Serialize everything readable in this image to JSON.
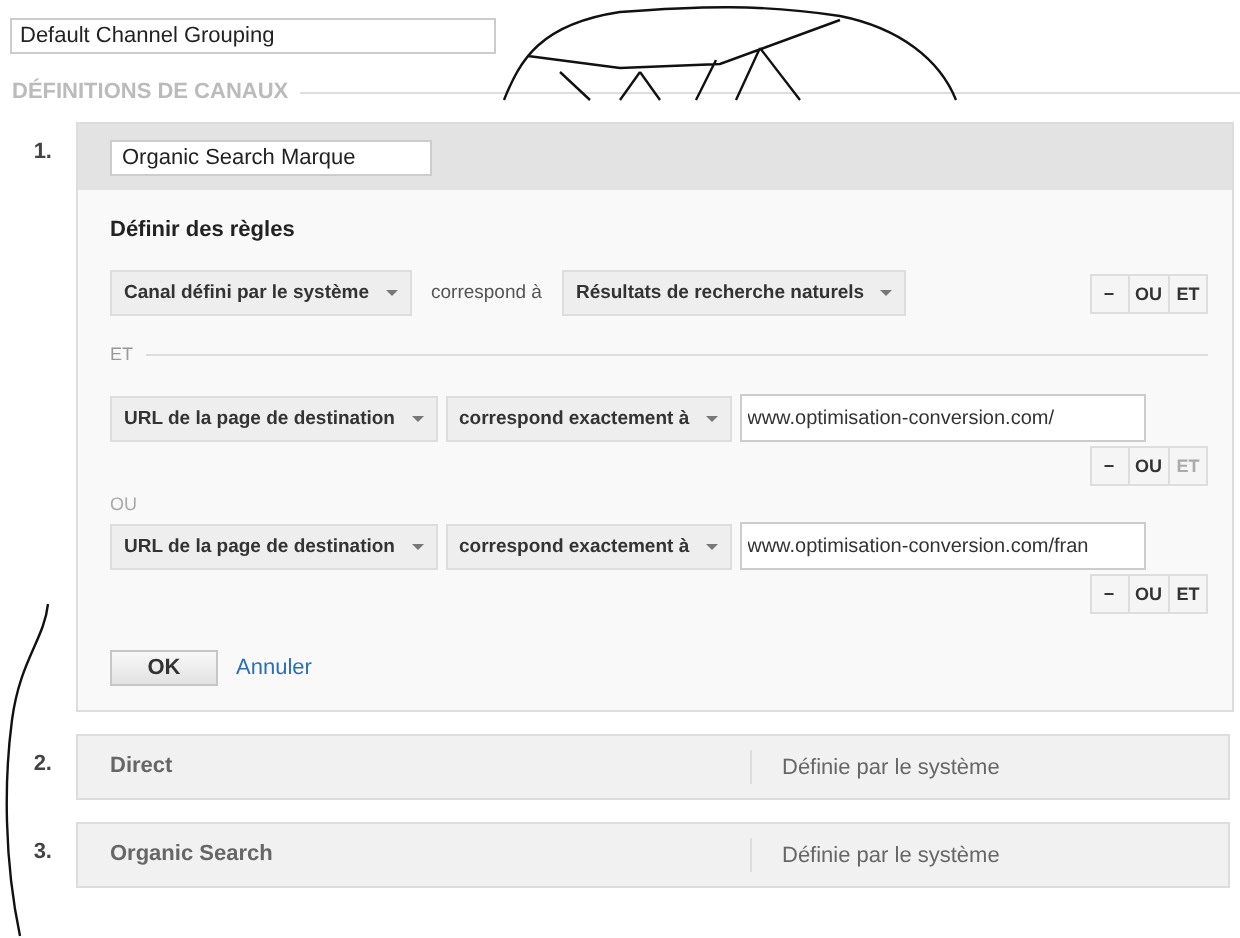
{
  "name_field": {
    "value": "Default Channel Grouping"
  },
  "section_title": "DÉFINITIONS DE CANAUX",
  "channels": [
    {
      "number": "1.",
      "expanded": true,
      "name_input": "Organic Search Marque",
      "rules_title": "Définir des règles",
      "rules": [
        {
          "kind": "rule",
          "dimension": "Canal défini par le système",
          "operator": {
            "kind": "text",
            "label": "correspond à"
          },
          "value": {
            "kind": "select",
            "label": "Résultats de recherche naturels"
          },
          "buttons": [
            {
              "label": "−",
              "disabled": false
            },
            {
              "label": "OU",
              "disabled": false
            },
            {
              "label": "ET",
              "disabled": false
            }
          ]
        },
        {
          "kind": "divider",
          "label": "ET"
        },
        {
          "kind": "rule",
          "dimension": "URL de la page de destination",
          "operator": {
            "kind": "select",
            "label": "correspond exactement à"
          },
          "value": {
            "kind": "input",
            "label": "www.optimisation-conversion.com/"
          },
          "buttons": [
            {
              "label": "−",
              "disabled": false
            },
            {
              "label": "OU",
              "disabled": false
            },
            {
              "label": "ET",
              "disabled": true
            }
          ]
        },
        {
          "kind": "label",
          "label": "OU"
        },
        {
          "kind": "rule",
          "dimension": "URL de la page de destination",
          "operator": {
            "kind": "select",
            "label": "correspond exactement à"
          },
          "value": {
            "kind": "input",
            "label": "www.optimisation-conversion.com/fran"
          },
          "buttons": [
            {
              "label": "−",
              "disabled": false
            },
            {
              "label": "OU",
              "disabled": false
            },
            {
              "label": "ET",
              "disabled": false
            }
          ]
        }
      ],
      "ok": "OK",
      "cancel": "Annuler"
    },
    {
      "number": "2.",
      "expanded": false,
      "name": "Direct",
      "type": "Définie par le système"
    },
    {
      "number": "3.",
      "expanded": false,
      "name": "Organic Search",
      "type": "Définie par le système"
    }
  ]
}
